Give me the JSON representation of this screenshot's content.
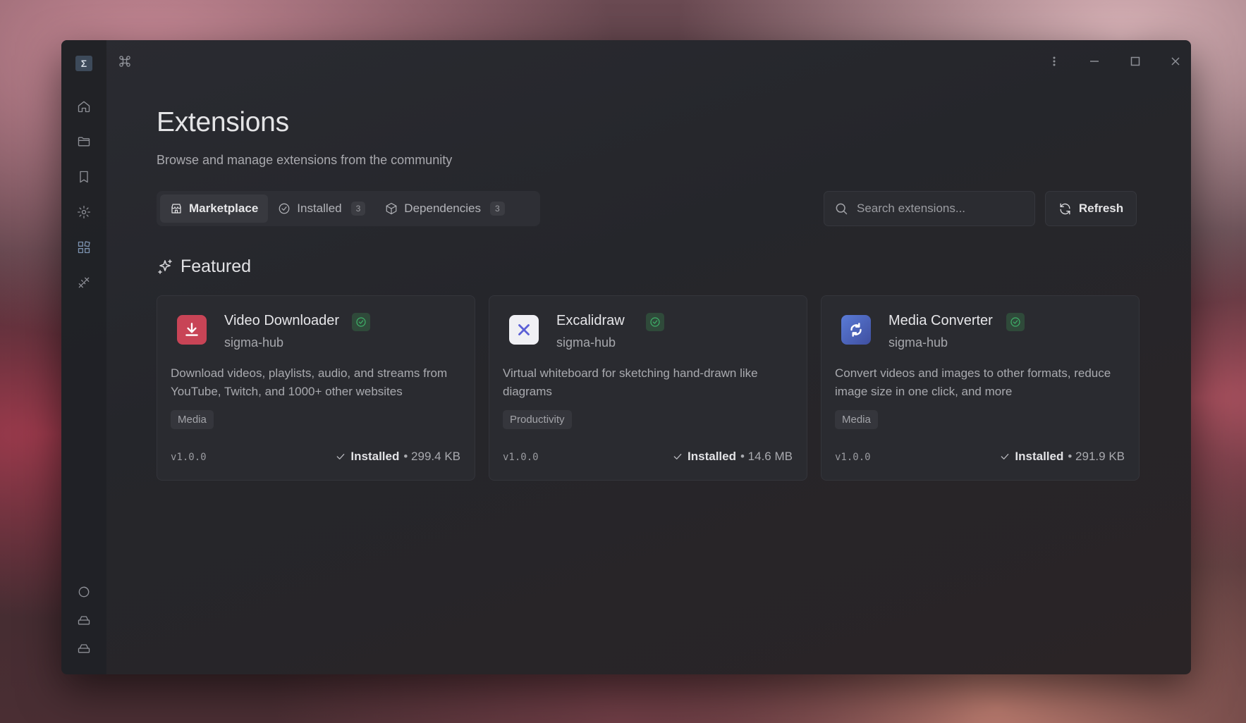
{
  "app": {
    "logo_text": "Σ"
  },
  "sidebar": {
    "items": [
      {
        "icon": "home-icon"
      },
      {
        "icon": "folder-icon"
      },
      {
        "icon": "bookmark-icon"
      },
      {
        "icon": "gear-icon"
      },
      {
        "icon": "extensions-icon",
        "active": true
      },
      {
        "icon": "tools-icon"
      }
    ],
    "bottom_items": [
      {
        "icon": "loader-icon"
      },
      {
        "icon": "drive-icon"
      },
      {
        "icon": "drive-icon"
      }
    ]
  },
  "page": {
    "title": "Extensions",
    "subtitle": "Browse and manage extensions from the community"
  },
  "tabs": [
    {
      "label": "Marketplace",
      "icon": "store-icon",
      "active": true
    },
    {
      "label": "Installed",
      "icon": "check-circle-icon",
      "count": "3"
    },
    {
      "label": "Dependencies",
      "icon": "package-icon",
      "count": "3"
    }
  ],
  "search": {
    "placeholder": "Search extensions..."
  },
  "refresh": {
    "label": "Refresh"
  },
  "featured": {
    "heading": "Featured"
  },
  "cards": [
    {
      "name": "Video Downloader",
      "author": "sigma-hub",
      "description": "Download videos, playlists, audio, and streams from YouTube, Twitch, and 1000+ other websites",
      "tag": "Media",
      "version": "v1.0.0",
      "status": "Installed",
      "size": "• 299.4 KB",
      "icon": "download-icon",
      "icon_color": "#d94b5c"
    },
    {
      "name": "Excalidraw",
      "author": "sigma-hub",
      "description": "Virtual whiteboard for sketching hand-drawn like diagrams",
      "tag": "Productivity",
      "version": "v1.0.0",
      "status": "Installed",
      "size": "• 14.6 MB",
      "icon": "excalidraw-icon",
      "icon_color": "#f2f2f6"
    },
    {
      "name": "Media Converter",
      "author": "sigma-hub",
      "description": "Convert videos and images to other formats, reduce image size in one click, and more",
      "tag": "Media",
      "version": "v1.0.0",
      "status": "Installed",
      "size": "• 291.9 KB",
      "icon": "convert-icon",
      "icon_color": "#4d63b8"
    }
  ],
  "colors": {
    "accent_green": "#3fb36a",
    "window_bg": "#26272c"
  }
}
